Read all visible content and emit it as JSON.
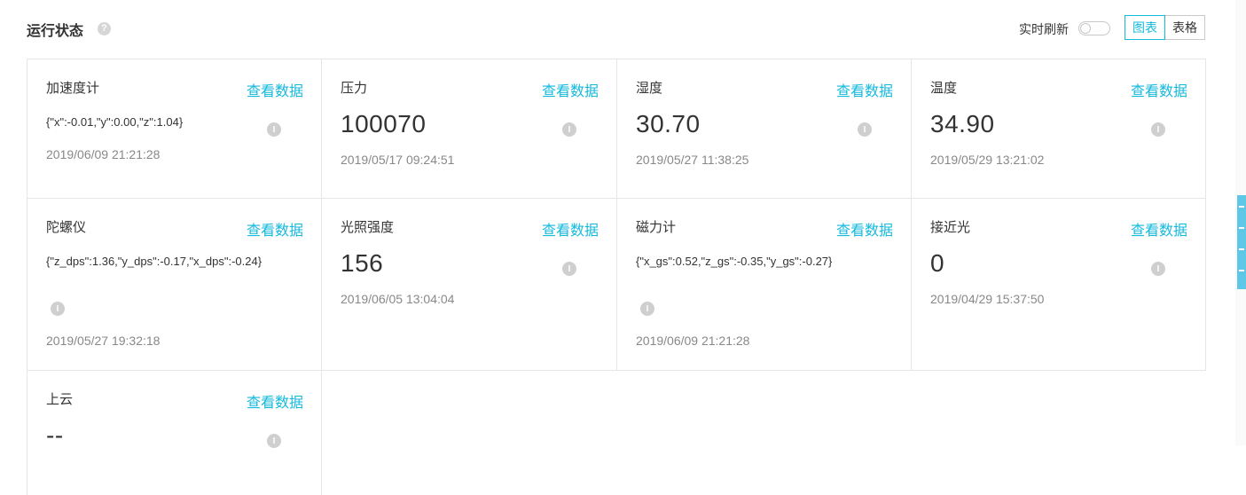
{
  "header": {
    "title": "运行状态",
    "help_icon": "question-circle-icon",
    "realtime_label": "实时刷新",
    "realtime_enabled": false,
    "view_chart": "图表",
    "view_table": "表格",
    "active_view": "图表"
  },
  "accent_color": "#14b9dc",
  "cards": [
    {
      "name": "加速度计",
      "link": "查看数据",
      "value": "{\"x\":-0.01,\"y\":0.00,\"z\":1.04}",
      "time": "2019/06/09 21:21:28"
    },
    {
      "name": "压力",
      "link": "查看数据",
      "value": "100070",
      "time": "2019/05/17 09:24:51"
    },
    {
      "name": "湿度",
      "link": "查看数据",
      "value": "30.70",
      "time": "2019/05/27 11:38:25"
    },
    {
      "name": "温度",
      "link": "查看数据",
      "value": "34.90",
      "time": "2019/05/29 13:21:02"
    },
    {
      "name": "陀螺仪",
      "link": "查看数据",
      "value": "{\"z_dps\":1.36,\"y_dps\":-0.17,\"x_dps\":-0.24}",
      "time": "2019/05/27 19:32:18"
    },
    {
      "name": "光照强度",
      "link": "查看数据",
      "value": "156",
      "time": "2019/06/05 13:04:04"
    },
    {
      "name": "磁力计",
      "link": "查看数据",
      "value": "{\"x_gs\":0.52,\"z_gs\":-0.35,\"y_gs\":-0.27}",
      "time": "2019/06/09 21:21:28"
    },
    {
      "name": "接近光",
      "link": "查看数据",
      "value": "0",
      "time": "2019/04/29 15:37:50"
    },
    {
      "name": "上云",
      "link": "查看数据",
      "value": "--",
      "time": ""
    }
  ]
}
